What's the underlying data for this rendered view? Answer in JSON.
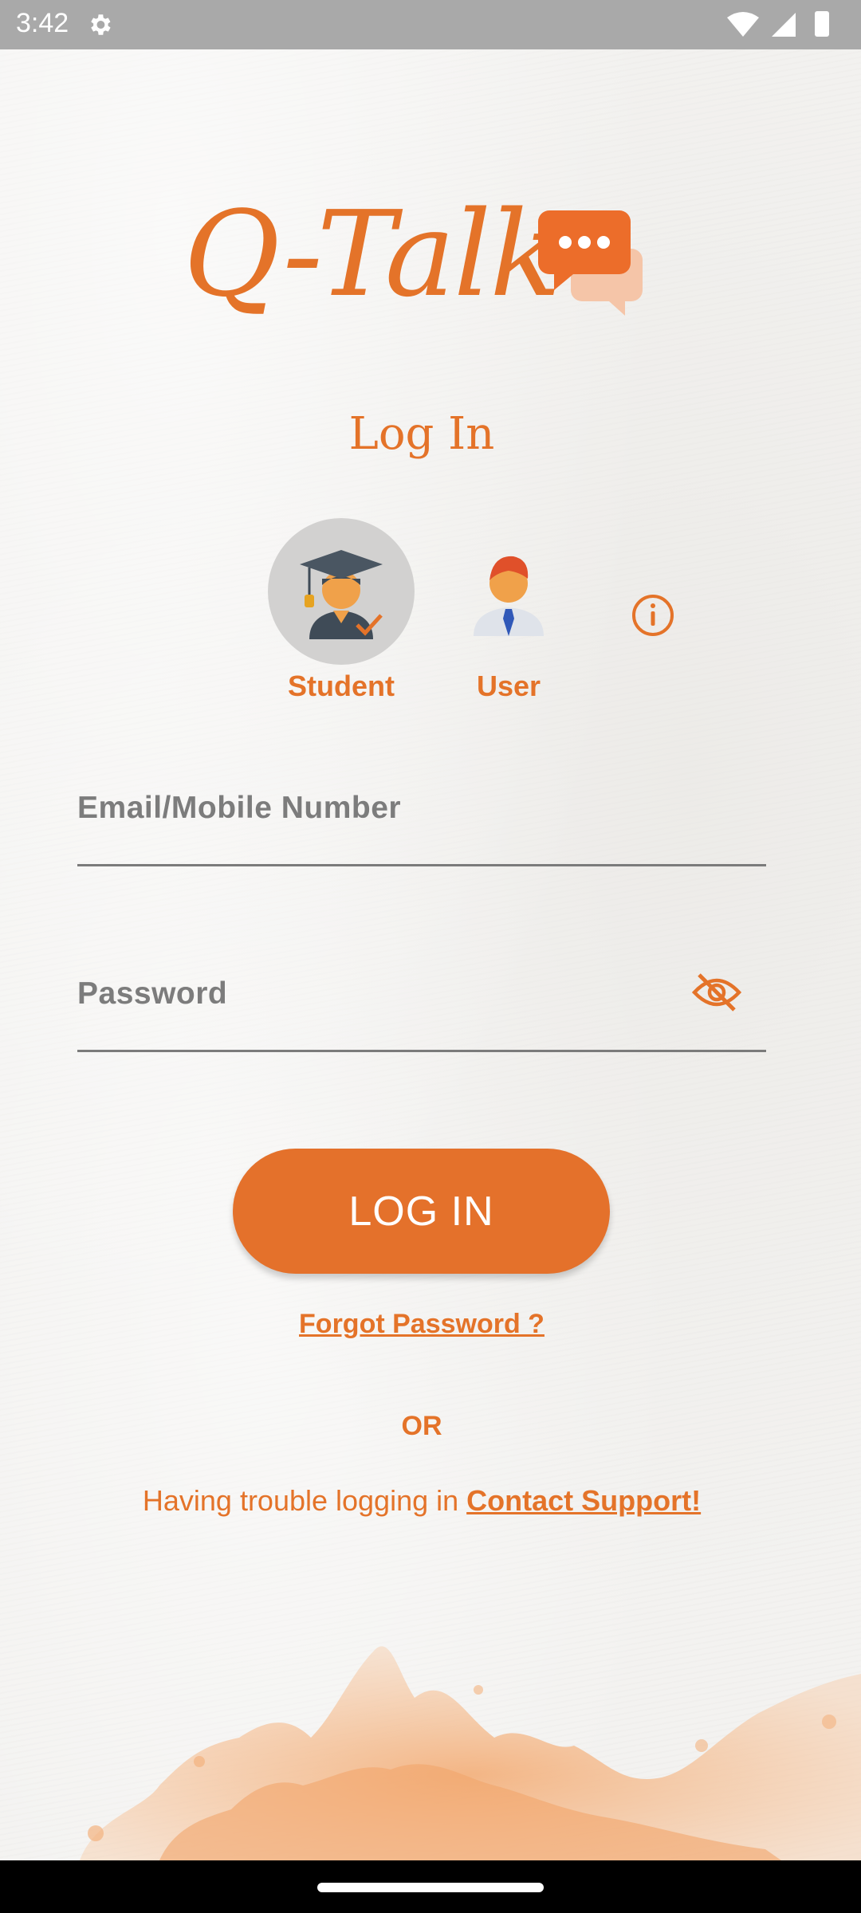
{
  "status_bar": {
    "time": "3:42",
    "icons": [
      "settings-icon",
      "wifi-icon",
      "signal-icon",
      "battery-icon"
    ]
  },
  "app": {
    "logo_text": "Q-Talk",
    "logo_icon": "chat-bubbles-icon",
    "brand_color": "#e47329"
  },
  "screen": {
    "title": "Log In"
  },
  "roles": [
    {
      "label": "Student",
      "icon": "graduate-avatar-icon",
      "selected": true
    },
    {
      "label": "User",
      "icon": "user-avatar-icon",
      "selected": false
    }
  ],
  "form": {
    "email_placeholder": "Email/Mobile Number",
    "email_value": "",
    "password_placeholder": "Password",
    "password_value": "",
    "password_toggle_icon": "eye-off-icon",
    "submit_label": "LOG IN"
  },
  "links": {
    "forgot_password": "Forgot Password ?",
    "or": "OR",
    "trouble_text": "Having trouble logging in",
    "contact_support": "Contact Support!"
  }
}
